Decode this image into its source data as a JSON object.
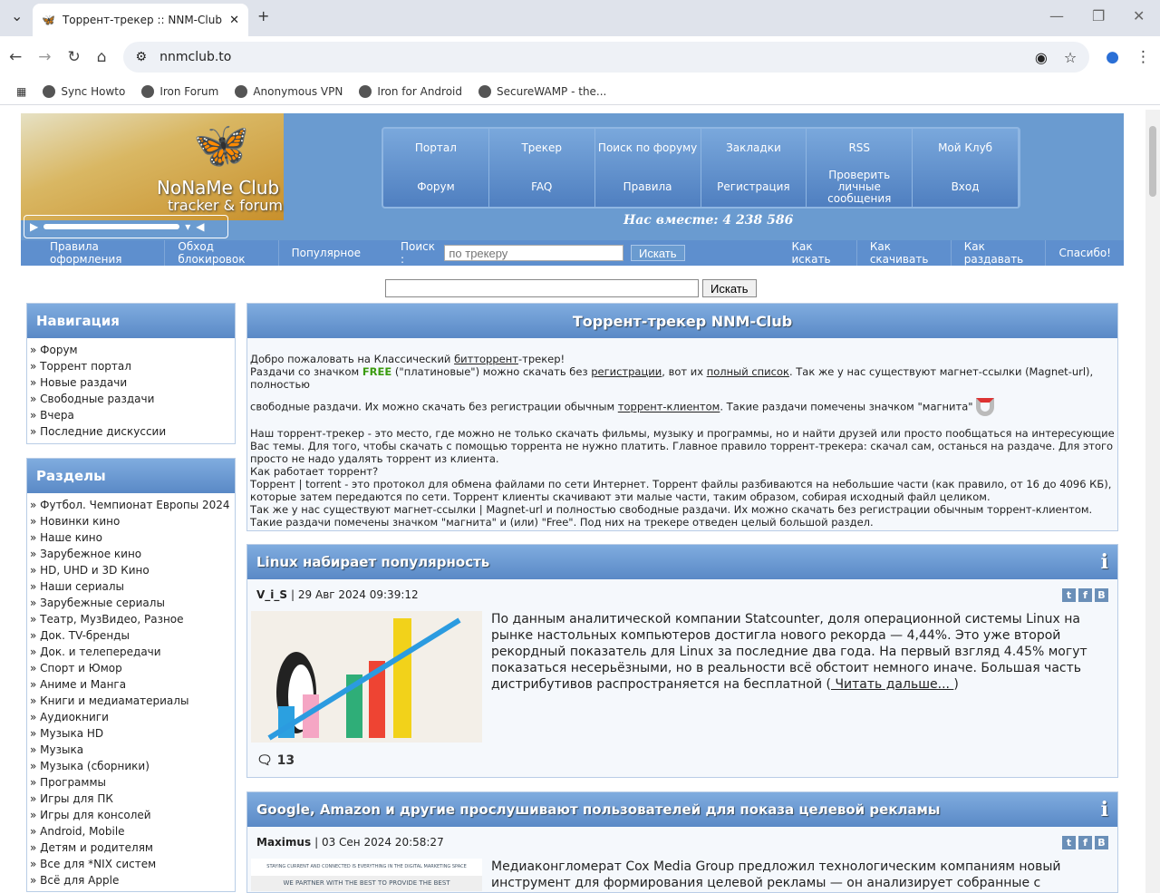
{
  "browser": {
    "tab_title": "Торрент-трекер :: NNM-Club",
    "url": "nnmclub.to",
    "bookmarks": [
      "Sync Howto",
      "Iron Forum",
      "Anonymous VPN",
      "Iron for Android",
      "SecureWAMP - the..."
    ]
  },
  "logo": {
    "title": "NoNaMe Club",
    "subtitle": "tracker & forum"
  },
  "menu": [
    "Портал",
    "Трекер",
    "Поиск по форуму",
    "Закладки",
    "RSS",
    "Мой Клуб",
    "Форум",
    "FAQ",
    "Правила",
    "Регистрация",
    "Проверить личные сообщения",
    "Вход"
  ],
  "together": "Нас вместе: 4 238 586",
  "subnav": {
    "left": [
      "Правила оформления",
      "Обход блокировок",
      "Популярное"
    ],
    "search_label": "Поиск :",
    "search_placeholder": "по трекеру",
    "search_button": "Искать",
    "right": [
      "Как искать",
      "Как скачивать",
      "Как раздавать",
      "Спасибо!"
    ]
  },
  "global_search": {
    "button": "Искать"
  },
  "nav": {
    "title": "Навигация",
    "items": [
      "Форум",
      "Торрент портал",
      "Новые раздачи",
      "Свободные раздачи",
      "Вчера",
      "Последние дискуссии"
    ]
  },
  "sections": {
    "title": "Разделы",
    "items": [
      "Футбол. Чемпионат Европы 2024",
      "Новинки кино",
      "Наше кино",
      "Зарубежное кино",
      "HD, UHD и 3D Кино",
      "Наши сериалы",
      "Зарубежные сериалы",
      "Театр, МузВидео, Разное",
      "Док. TV-бренды",
      "Док. и телепередачи",
      "Спорт и Юмор",
      "Аниме и Манга",
      "Книги и медиаматериалы",
      "Аудиокниги",
      "Музыка HD",
      "Музыка",
      "Музыка (сборники)",
      "Программы",
      "Игры для ПК",
      "Игры для консолей",
      "Android, Mobile",
      "Детям и родителям",
      "Все для *NIX систем",
      "Всё для Apple"
    ]
  },
  "welcome": {
    "title": "Торрент-трекер NNM-Club",
    "l1a": "Добро пожаловать на Классический ",
    "l1link": "битторрент",
    "l1b": "-трекер!",
    "l2a": "Раздачи со значком ",
    "free": "FREE",
    "l2b": " (\"платиновые\") можно скачать без ",
    "l2link1": "регистрации",
    "l2c": ", вот их ",
    "l2link2": "полный список",
    "l2d": ". Так же у нас существуют магнет-ссылки (Magnet-url), полностью",
    "l3a": "свободные раздачи. Их можно скачать без регистрации обычным ",
    "l3link": "торрент-клиентом",
    "l3b": ". Такие раздачи помечены значком \"магнита\"",
    "p2": "Наш торрент-трекер - это место, где можно не только скачать фильмы, музыку и программы, но и найти друзей или просто пообщаться на интересующие Вас темы. Для того, чтобы скачать с помощью торрента не нужно платить. Главное правило торрент-трекера: скачал сам, останься на раздаче. Для этого просто не надо удалять торрент из клиента.",
    "p3": "Как работает торрент?",
    "p4": "Торрент | torrent - это протокол для обмена файлами по сети Интернет. Торрент файлы разбиваются на небольшие части (как правило, от 16 до 4096 КБ), которые затем передаются по сети. Торрент клиенты скачивают эти малые части, таким образом, собирая исходный файл целиком.",
    "p5": "Так же у нас существуют магнет-ссылки | Magnet-url и полностью свободные раздачи. Их можно скачать без регистрации обычным торрент-клиентом. Такие раздачи помечены значком \"магнита\" и (или) \"Free\". Под них на трекере отведен целый большой раздел."
  },
  "articles": [
    {
      "title": "Linux набирает популярность",
      "author": "V_i_S",
      "date": "| 29 Авг 2024 09:39:12",
      "text": "По данным аналитической компании Statcounter, доля операционной системы Linux на рынке настольных компьютеров достигла нового рекорда — 4,44%. Это уже второй рекордный показатель для Linux за последние два года. На первый взгляд 4.45% могут показаться несерьёзными, но в реальности всё обстоит немного иначе. Большая часть дистрибутивов распространяется на бесплатной (",
      "more": " Читать дальше... ",
      "close": ")",
      "comments": "13"
    },
    {
      "title": "Google, Amazon и другие прослушивают пользователей для показа целевой рекламы",
      "author": "Maximus",
      "date": "| 03 Сен 2024 20:58:27",
      "text": "Медиаконгломерат Cox Media Group предложил технологическим компаниям новый инструмент для формирования целевой рекламы — он анализирует собранные с домашних устройств аудиозаписи. О",
      "img_line1": "STAYING CURRENT AND CONNECTED IS EVERYTHING IN THE DIGITAL MARKETING SPACE",
      "img_line2": "WE PARTNER WITH THE BEST TO PROVIDE THE BEST"
    }
  ]
}
